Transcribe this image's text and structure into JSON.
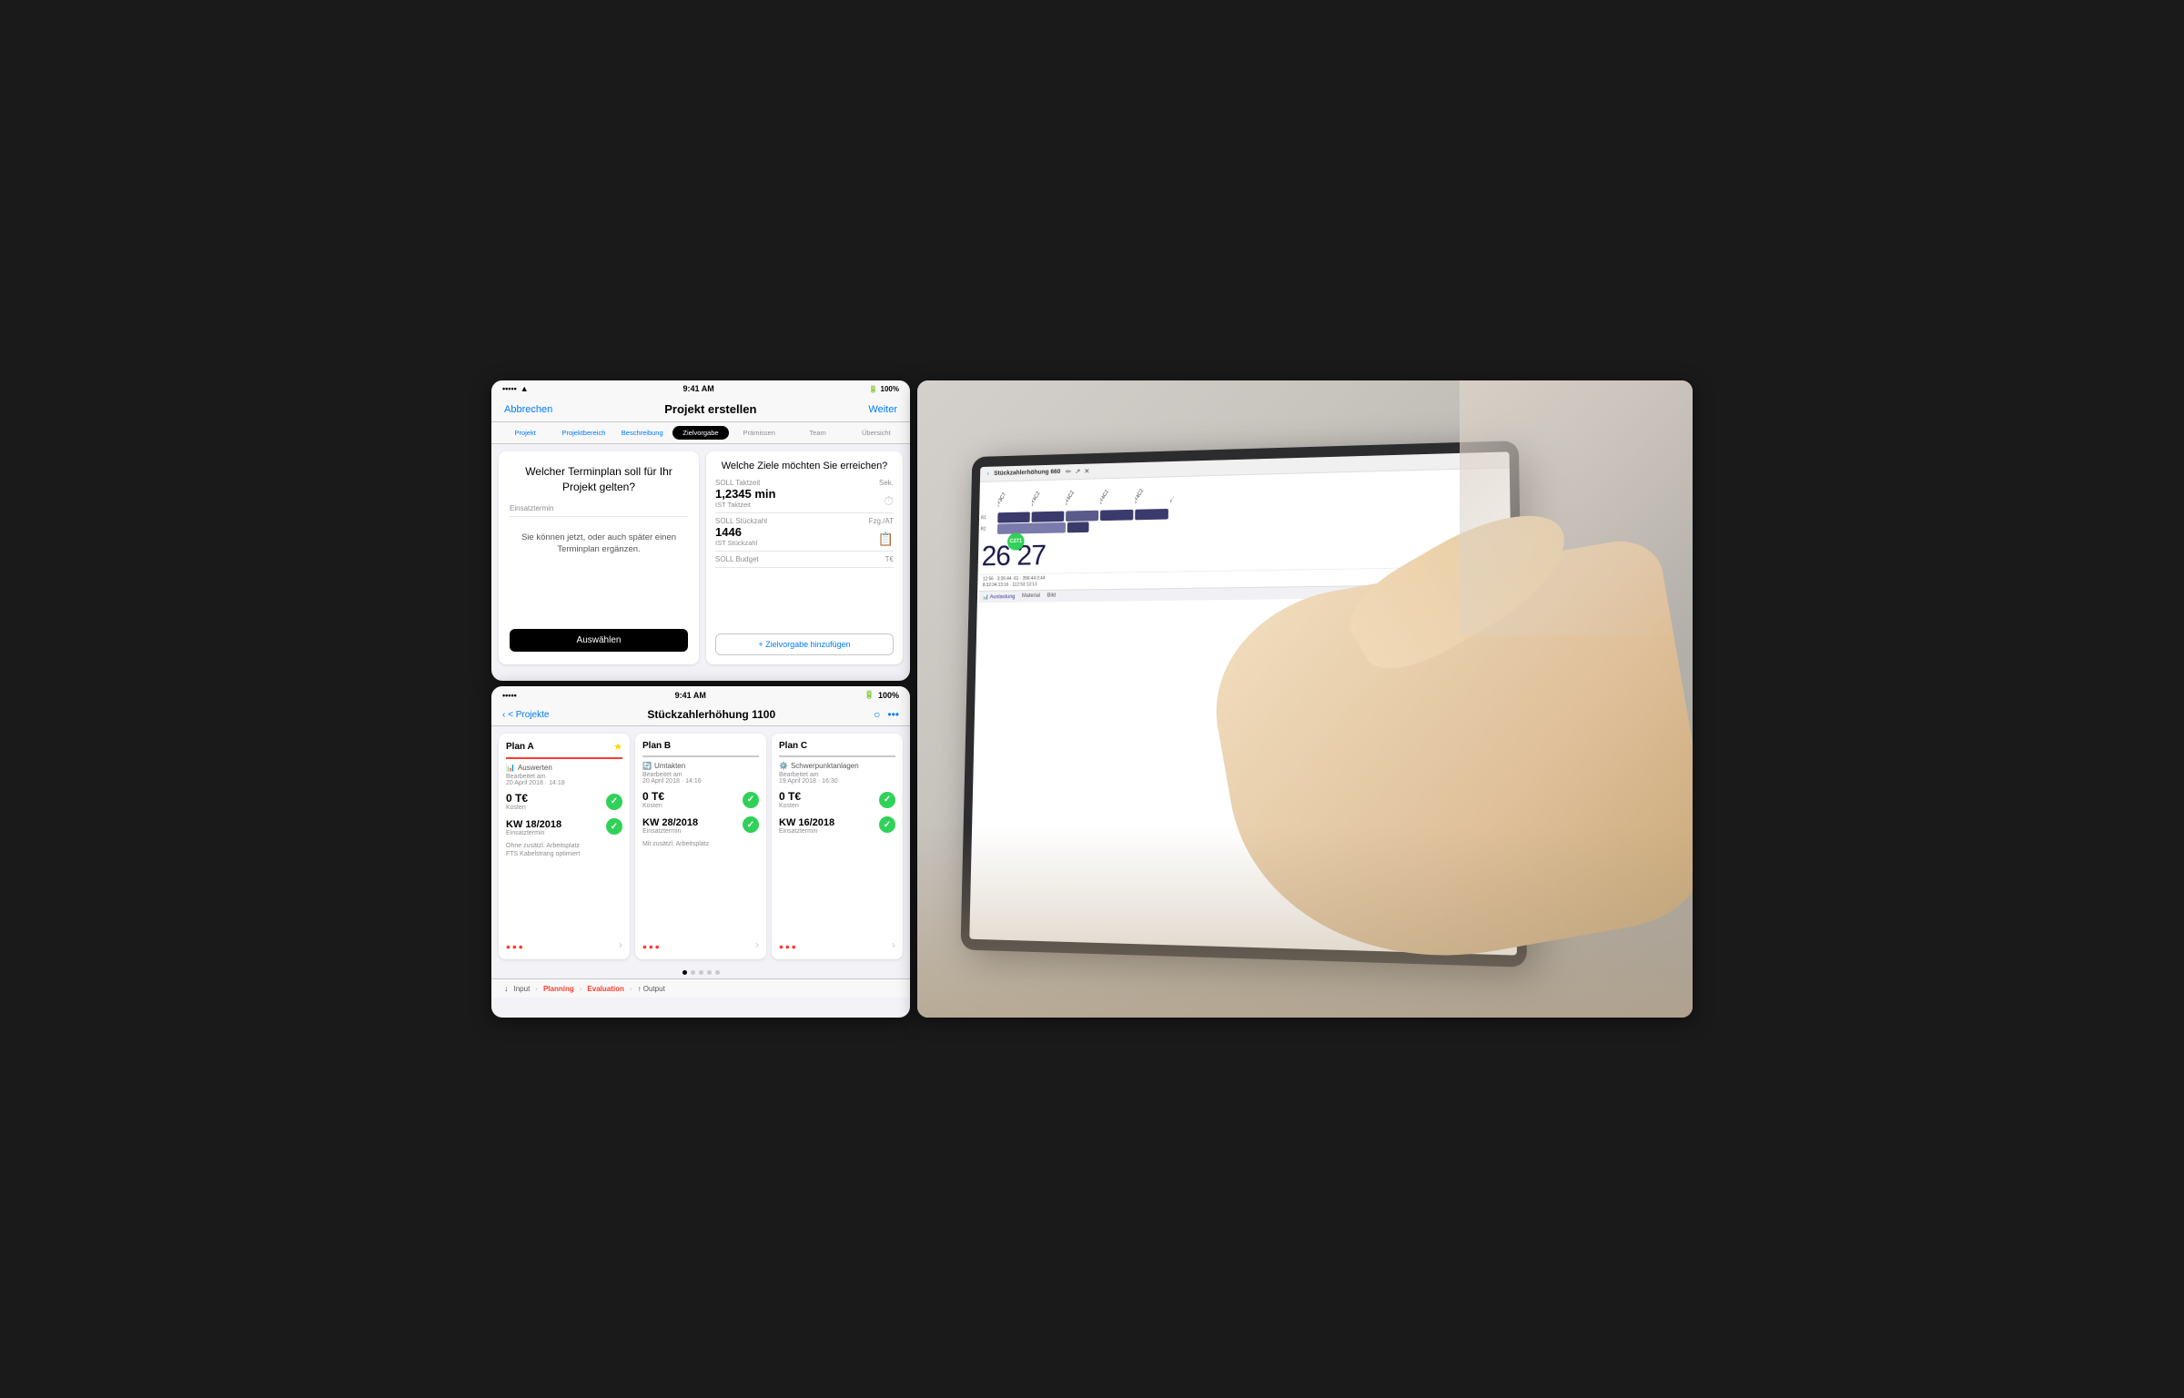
{
  "background": "#1a1a1a",
  "left_panel": {
    "top_screen": {
      "status_bar": {
        "dots": "•••••",
        "wifi": "wifi",
        "time": "9:41 AM",
        "battery": "100%"
      },
      "nav": {
        "cancel": "Abbrechen",
        "title": "Projekt erstellen",
        "action": "Weiter"
      },
      "steps": [
        {
          "label": "Projekt",
          "state": "done"
        },
        {
          "label": "Projektbereich",
          "state": "done"
        },
        {
          "label": "Beschreibung",
          "state": "done"
        },
        {
          "label": "Zielvorgabe",
          "state": "active"
        },
        {
          "label": "Prämissen",
          "state": "default"
        },
        {
          "label": "Team",
          "state": "default"
        },
        {
          "label": "Übersicht",
          "state": "default"
        }
      ],
      "left_card": {
        "title": "Welcher Terminplan soll für Ihr Projekt gelten?",
        "field_label": "Einsatztermin",
        "subtext": "Sie können jetzt, oder auch später einen Terminplan ergänzen.",
        "button": "Auswählen"
      },
      "right_card": {
        "title": "Welche Ziele möchten Sie erreichen?",
        "fields": [
          {
            "label": "SOLL Taktzeit",
            "unit": "Sek.",
            "value": "1,2345 min",
            "subvalue": "IST Taktzeit",
            "icon": "⏱"
          },
          {
            "label": "SOLL Stückzahl",
            "unit": "Fzg./AT",
            "value": "1446",
            "subvalue": "IST Stückzahl",
            "icon": "📋"
          },
          {
            "label": "SOLL Budget",
            "unit": "T€",
            "value": "",
            "subvalue": "",
            "icon": ""
          }
        ],
        "add_button": "+ Zielvorgabe hinzufügen"
      }
    },
    "bottom_screen": {
      "status_bar": {
        "dots": "•••••",
        "wifi": "wifi",
        "time": "9:41 AM",
        "battery": "100%"
      },
      "nav": {
        "back": "< Projekte",
        "title": "Stückzahlerhöhung 1100",
        "icons": "○ •••"
      },
      "plans": [
        {
          "id": "A",
          "name": "Plan A",
          "starred": true,
          "action_icon": "📊",
          "action": "Auswerten",
          "edited": "Bearbeitet am\n20 April 2018 · 14:18",
          "cost": "0 T€",
          "cost_label": "Kosten",
          "date": "KW 18/2018",
          "date_label": "Einsatztermin",
          "note": "Ohne zusätzl. Arbeitsplatz\nFTS Kabelstrang optimiert",
          "border_color": "#ff3b30"
        },
        {
          "id": "B",
          "name": "Plan B",
          "starred": false,
          "action_icon": "🔄",
          "action": "Umtakten",
          "edited": "Bearbeitet am\n20 April 2018 · 14:16",
          "cost": "0 T€",
          "cost_label": "Kosten",
          "date": "KW 28/2018",
          "date_label": "Einsatztermin",
          "note": "Mit zusätzl. Arbeitsplatz",
          "border_color": "#c8c8cd"
        },
        {
          "id": "C",
          "name": "Plan C",
          "starred": false,
          "action_icon": "⚙️",
          "action": "Schwerpunktanlagen",
          "edited": "Bearbeitet am\n19 April 2018 · 16:30",
          "cost": "0 T€",
          "cost_label": "Kosten",
          "date": "KW 16/2018",
          "date_label": "Einsatztermin",
          "note": "",
          "border_color": "#c8c8cd"
        }
      ],
      "toolbar": {
        "items": [
          "Input",
          "Planning",
          "Evaluation",
          "Output"
        ],
        "active": "Planning"
      }
    }
  },
  "tablet_screen": {
    "title": "Stückzahlerhöhung 660",
    "numbers": [
      "26",
      "27"
    ],
    "badge": "C271",
    "bar_labels": [
      "10Y3C7",
      "T0Y4C2",
      "T0Y4C2",
      "T0Y4C2",
      "T0Y4C2",
      "Ka..."
    ]
  }
}
